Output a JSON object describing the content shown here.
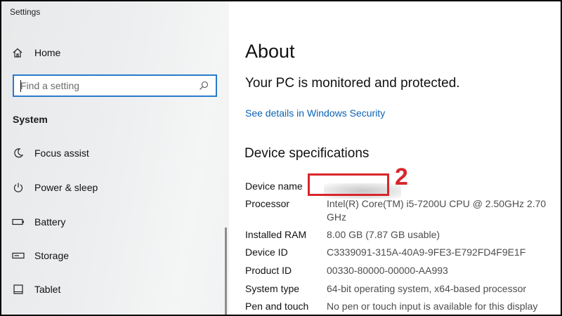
{
  "window": {
    "title": "Settings"
  },
  "sidebar": {
    "home_label": "Home",
    "search_placeholder": "Find a setting",
    "section_heading": "System",
    "items": [
      {
        "label": "Focus assist",
        "icon": "moon-icon"
      },
      {
        "label": "Power & sleep",
        "icon": "power-icon"
      },
      {
        "label": "Battery",
        "icon": "battery-icon"
      },
      {
        "label": "Storage",
        "icon": "storage-icon"
      },
      {
        "label": "Tablet",
        "icon": "tablet-icon"
      }
    ]
  },
  "main": {
    "title": "About",
    "protection_text": "Your PC is monitored and protected.",
    "security_link": "See details in Windows Security",
    "spec_heading": "Device specifications",
    "specs": [
      {
        "key": "Device name",
        "value": ""
      },
      {
        "key": "Processor",
        "value": "Intel(R) Core(TM) i5-7200U CPU @ 2.50GHz   2.70 GHz"
      },
      {
        "key": "Installed RAM",
        "value": "8.00 GB (7.87 GB usable)"
      },
      {
        "key": "Device ID",
        "value": "C3339091-315A-40A9-9FE3-E792FD4F9E1F"
      },
      {
        "key": "Product ID",
        "value": "00330-80000-00000-AA993"
      },
      {
        "key": "System type",
        "value": "64-bit operating system, x64-based processor"
      },
      {
        "key": "Pen and touch",
        "value": "No pen or touch input is available for this display"
      }
    ]
  },
  "annotation": {
    "step_number": "2",
    "color": "#d7262b"
  },
  "colors": {
    "accent": "#0b63b5",
    "search_border": "#2a7bc9"
  }
}
